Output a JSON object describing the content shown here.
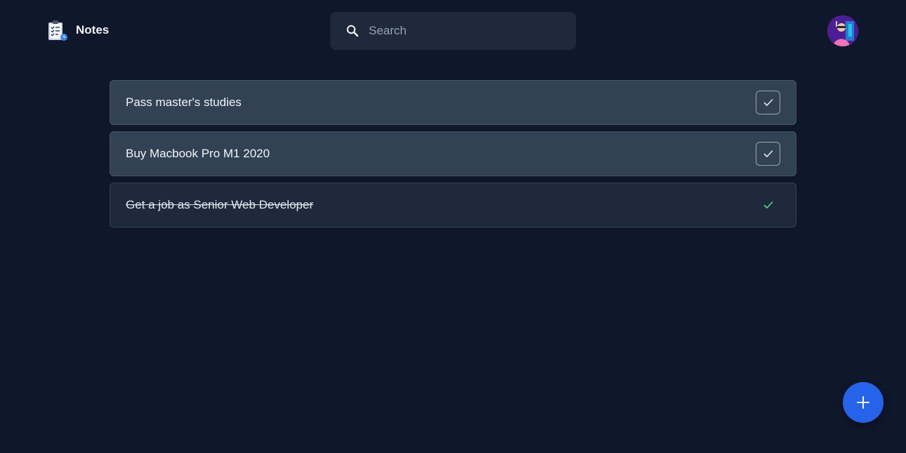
{
  "app": {
    "title": "Notes"
  },
  "search": {
    "placeholder": "Search",
    "value": ""
  },
  "notes": [
    {
      "text": "Pass master's studies",
      "completed": false
    },
    {
      "text": "Buy Macbook Pro M1 2020",
      "completed": false
    },
    {
      "text": "Get a job as Senior Web Developer",
      "completed": true
    }
  ],
  "icons": {
    "logo": "clipboard-checklist-icon",
    "search": "search-icon",
    "check": "check-icon",
    "add": "plus-icon"
  },
  "colors": {
    "background": "#0f172a",
    "card": "#334155",
    "card_done": "#1e293b",
    "accent": "#2563eb",
    "success": "#4ade80"
  }
}
